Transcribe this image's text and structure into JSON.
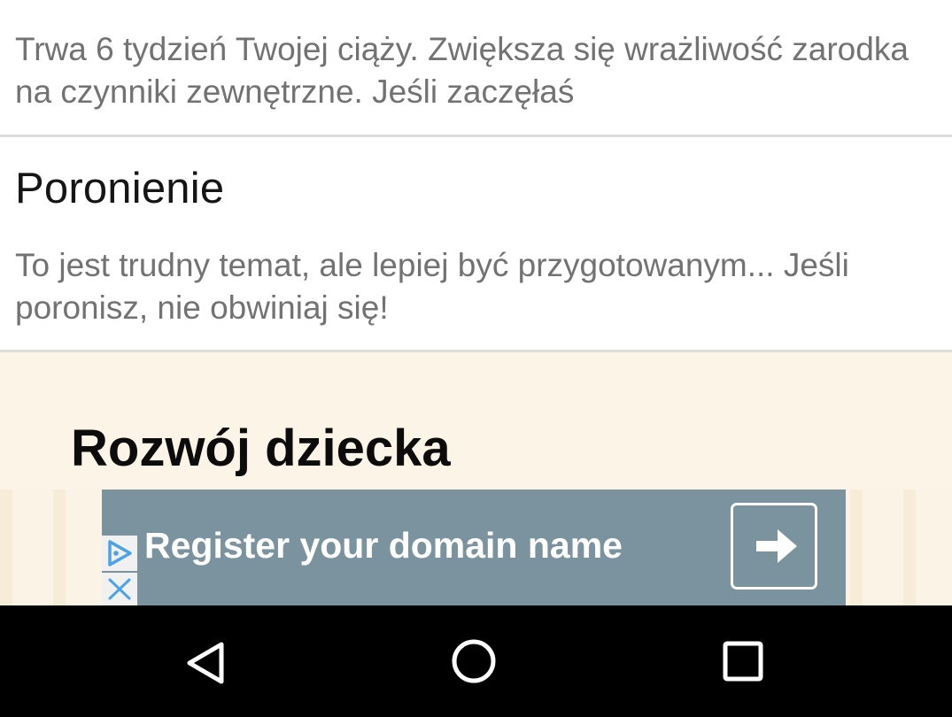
{
  "articles": [
    {
      "title": "",
      "text": "Trwa 6 tydzień Twojej ciąży. Zwiększa się wrażliwość zarodka na czynniki zewnętrzne. Jeśli zaczęłaś"
    },
    {
      "title": "Poronienie",
      "text": "To jest trudny temat, ale lepiej być przygotowanym... Jeśli poronisz, nie obwiniaj się!"
    }
  ],
  "section": {
    "title": "Rozwój dziecka"
  },
  "ad": {
    "text": "Register your domain name",
    "background": "#7b939e"
  },
  "navigation": {
    "back": "back-icon",
    "home": "home-icon",
    "recents": "recents-icon"
  },
  "colors": {
    "section_bg": "#fcf5e7",
    "divider": "#dcdcdc",
    "secondary_text": "#727272",
    "ad_choices": "#4aa3e8"
  }
}
